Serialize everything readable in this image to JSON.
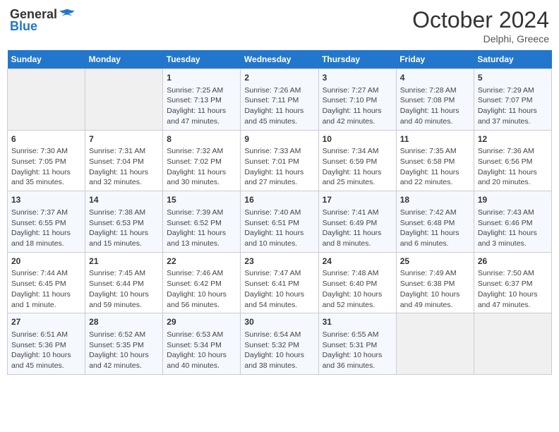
{
  "header": {
    "logo_general": "General",
    "logo_blue": "Blue",
    "month_title": "October 2024",
    "location": "Delphi, Greece"
  },
  "weekdays": [
    "Sunday",
    "Monday",
    "Tuesday",
    "Wednesday",
    "Thursday",
    "Friday",
    "Saturday"
  ],
  "weeks": [
    [
      {
        "day": "",
        "content": ""
      },
      {
        "day": "",
        "content": ""
      },
      {
        "day": "1",
        "content": "Sunrise: 7:25 AM\nSunset: 7:13 PM\nDaylight: 11 hours and 47 minutes."
      },
      {
        "day": "2",
        "content": "Sunrise: 7:26 AM\nSunset: 7:11 PM\nDaylight: 11 hours and 45 minutes."
      },
      {
        "day": "3",
        "content": "Sunrise: 7:27 AM\nSunset: 7:10 PM\nDaylight: 11 hours and 42 minutes."
      },
      {
        "day": "4",
        "content": "Sunrise: 7:28 AM\nSunset: 7:08 PM\nDaylight: 11 hours and 40 minutes."
      },
      {
        "day": "5",
        "content": "Sunrise: 7:29 AM\nSunset: 7:07 PM\nDaylight: 11 hours and 37 minutes."
      }
    ],
    [
      {
        "day": "6",
        "content": "Sunrise: 7:30 AM\nSunset: 7:05 PM\nDaylight: 11 hours and 35 minutes."
      },
      {
        "day": "7",
        "content": "Sunrise: 7:31 AM\nSunset: 7:04 PM\nDaylight: 11 hours and 32 minutes."
      },
      {
        "day": "8",
        "content": "Sunrise: 7:32 AM\nSunset: 7:02 PM\nDaylight: 11 hours and 30 minutes."
      },
      {
        "day": "9",
        "content": "Sunrise: 7:33 AM\nSunset: 7:01 PM\nDaylight: 11 hours and 27 minutes."
      },
      {
        "day": "10",
        "content": "Sunrise: 7:34 AM\nSunset: 6:59 PM\nDaylight: 11 hours and 25 minutes."
      },
      {
        "day": "11",
        "content": "Sunrise: 7:35 AM\nSunset: 6:58 PM\nDaylight: 11 hours and 22 minutes."
      },
      {
        "day": "12",
        "content": "Sunrise: 7:36 AM\nSunset: 6:56 PM\nDaylight: 11 hours and 20 minutes."
      }
    ],
    [
      {
        "day": "13",
        "content": "Sunrise: 7:37 AM\nSunset: 6:55 PM\nDaylight: 11 hours and 18 minutes."
      },
      {
        "day": "14",
        "content": "Sunrise: 7:38 AM\nSunset: 6:53 PM\nDaylight: 11 hours and 15 minutes."
      },
      {
        "day": "15",
        "content": "Sunrise: 7:39 AM\nSunset: 6:52 PM\nDaylight: 11 hours and 13 minutes."
      },
      {
        "day": "16",
        "content": "Sunrise: 7:40 AM\nSunset: 6:51 PM\nDaylight: 11 hours and 10 minutes."
      },
      {
        "day": "17",
        "content": "Sunrise: 7:41 AM\nSunset: 6:49 PM\nDaylight: 11 hours and 8 minutes."
      },
      {
        "day": "18",
        "content": "Sunrise: 7:42 AM\nSunset: 6:48 PM\nDaylight: 11 hours and 6 minutes."
      },
      {
        "day": "19",
        "content": "Sunrise: 7:43 AM\nSunset: 6:46 PM\nDaylight: 11 hours and 3 minutes."
      }
    ],
    [
      {
        "day": "20",
        "content": "Sunrise: 7:44 AM\nSunset: 6:45 PM\nDaylight: 11 hours and 1 minute."
      },
      {
        "day": "21",
        "content": "Sunrise: 7:45 AM\nSunset: 6:44 PM\nDaylight: 10 hours and 59 minutes."
      },
      {
        "day": "22",
        "content": "Sunrise: 7:46 AM\nSunset: 6:42 PM\nDaylight: 10 hours and 56 minutes."
      },
      {
        "day": "23",
        "content": "Sunrise: 7:47 AM\nSunset: 6:41 PM\nDaylight: 10 hours and 54 minutes."
      },
      {
        "day": "24",
        "content": "Sunrise: 7:48 AM\nSunset: 6:40 PM\nDaylight: 10 hours and 52 minutes."
      },
      {
        "day": "25",
        "content": "Sunrise: 7:49 AM\nSunset: 6:38 PM\nDaylight: 10 hours and 49 minutes."
      },
      {
        "day": "26",
        "content": "Sunrise: 7:50 AM\nSunset: 6:37 PM\nDaylight: 10 hours and 47 minutes."
      }
    ],
    [
      {
        "day": "27",
        "content": "Sunrise: 6:51 AM\nSunset: 5:36 PM\nDaylight: 10 hours and 45 minutes."
      },
      {
        "day": "28",
        "content": "Sunrise: 6:52 AM\nSunset: 5:35 PM\nDaylight: 10 hours and 42 minutes."
      },
      {
        "day": "29",
        "content": "Sunrise: 6:53 AM\nSunset: 5:34 PM\nDaylight: 10 hours and 40 minutes."
      },
      {
        "day": "30",
        "content": "Sunrise: 6:54 AM\nSunset: 5:32 PM\nDaylight: 10 hours and 38 minutes."
      },
      {
        "day": "31",
        "content": "Sunrise: 6:55 AM\nSunset: 5:31 PM\nDaylight: 10 hours and 36 minutes."
      },
      {
        "day": "",
        "content": ""
      },
      {
        "day": "",
        "content": ""
      }
    ]
  ]
}
